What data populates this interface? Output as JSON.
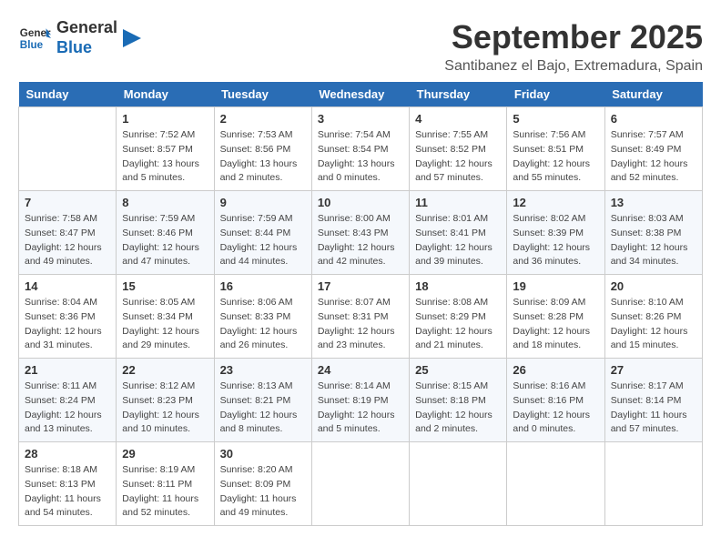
{
  "header": {
    "logo_line1": "General",
    "logo_line2": "Blue",
    "month_title": "September 2025",
    "location": "Santibanez el Bajo, Extremadura, Spain"
  },
  "weekdays": [
    "Sunday",
    "Monday",
    "Tuesday",
    "Wednesday",
    "Thursday",
    "Friday",
    "Saturday"
  ],
  "weeks": [
    [
      null,
      {
        "day": 1,
        "sunrise": "7:52 AM",
        "sunset": "8:57 PM",
        "daylight": "13 hours and 5 minutes."
      },
      {
        "day": 2,
        "sunrise": "7:53 AM",
        "sunset": "8:56 PM",
        "daylight": "13 hours and 2 minutes."
      },
      {
        "day": 3,
        "sunrise": "7:54 AM",
        "sunset": "8:54 PM",
        "daylight": "13 hours and 0 minutes."
      },
      {
        "day": 4,
        "sunrise": "7:55 AM",
        "sunset": "8:52 PM",
        "daylight": "12 hours and 57 minutes."
      },
      {
        "day": 5,
        "sunrise": "7:56 AM",
        "sunset": "8:51 PM",
        "daylight": "12 hours and 55 minutes."
      },
      {
        "day": 6,
        "sunrise": "7:57 AM",
        "sunset": "8:49 PM",
        "daylight": "12 hours and 52 minutes."
      }
    ],
    [
      {
        "day": 7,
        "sunrise": "7:58 AM",
        "sunset": "8:47 PM",
        "daylight": "12 hours and 49 minutes."
      },
      {
        "day": 8,
        "sunrise": "7:59 AM",
        "sunset": "8:46 PM",
        "daylight": "12 hours and 47 minutes."
      },
      {
        "day": 9,
        "sunrise": "7:59 AM",
        "sunset": "8:44 PM",
        "daylight": "12 hours and 44 minutes."
      },
      {
        "day": 10,
        "sunrise": "8:00 AM",
        "sunset": "8:43 PM",
        "daylight": "12 hours and 42 minutes."
      },
      {
        "day": 11,
        "sunrise": "8:01 AM",
        "sunset": "8:41 PM",
        "daylight": "12 hours and 39 minutes."
      },
      {
        "day": 12,
        "sunrise": "8:02 AM",
        "sunset": "8:39 PM",
        "daylight": "12 hours and 36 minutes."
      },
      {
        "day": 13,
        "sunrise": "8:03 AM",
        "sunset": "8:38 PM",
        "daylight": "12 hours and 34 minutes."
      }
    ],
    [
      {
        "day": 14,
        "sunrise": "8:04 AM",
        "sunset": "8:36 PM",
        "daylight": "12 hours and 31 minutes."
      },
      {
        "day": 15,
        "sunrise": "8:05 AM",
        "sunset": "8:34 PM",
        "daylight": "12 hours and 29 minutes."
      },
      {
        "day": 16,
        "sunrise": "8:06 AM",
        "sunset": "8:33 PM",
        "daylight": "12 hours and 26 minutes."
      },
      {
        "day": 17,
        "sunrise": "8:07 AM",
        "sunset": "8:31 PM",
        "daylight": "12 hours and 23 minutes."
      },
      {
        "day": 18,
        "sunrise": "8:08 AM",
        "sunset": "8:29 PM",
        "daylight": "12 hours and 21 minutes."
      },
      {
        "day": 19,
        "sunrise": "8:09 AM",
        "sunset": "8:28 PM",
        "daylight": "12 hours and 18 minutes."
      },
      {
        "day": 20,
        "sunrise": "8:10 AM",
        "sunset": "8:26 PM",
        "daylight": "12 hours and 15 minutes."
      }
    ],
    [
      {
        "day": 21,
        "sunrise": "8:11 AM",
        "sunset": "8:24 PM",
        "daylight": "12 hours and 13 minutes."
      },
      {
        "day": 22,
        "sunrise": "8:12 AM",
        "sunset": "8:23 PM",
        "daylight": "12 hours and 10 minutes."
      },
      {
        "day": 23,
        "sunrise": "8:13 AM",
        "sunset": "8:21 PM",
        "daylight": "12 hours and 8 minutes."
      },
      {
        "day": 24,
        "sunrise": "8:14 AM",
        "sunset": "8:19 PM",
        "daylight": "12 hours and 5 minutes."
      },
      {
        "day": 25,
        "sunrise": "8:15 AM",
        "sunset": "8:18 PM",
        "daylight": "12 hours and 2 minutes."
      },
      {
        "day": 26,
        "sunrise": "8:16 AM",
        "sunset": "8:16 PM",
        "daylight": "12 hours and 0 minutes."
      },
      {
        "day": 27,
        "sunrise": "8:17 AM",
        "sunset": "8:14 PM",
        "daylight": "11 hours and 57 minutes."
      }
    ],
    [
      {
        "day": 28,
        "sunrise": "8:18 AM",
        "sunset": "8:13 PM",
        "daylight": "11 hours and 54 minutes."
      },
      {
        "day": 29,
        "sunrise": "8:19 AM",
        "sunset": "8:11 PM",
        "daylight": "11 hours and 52 minutes."
      },
      {
        "day": 30,
        "sunrise": "8:20 AM",
        "sunset": "8:09 PM",
        "daylight": "11 hours and 49 minutes."
      },
      null,
      null,
      null,
      null
    ]
  ]
}
